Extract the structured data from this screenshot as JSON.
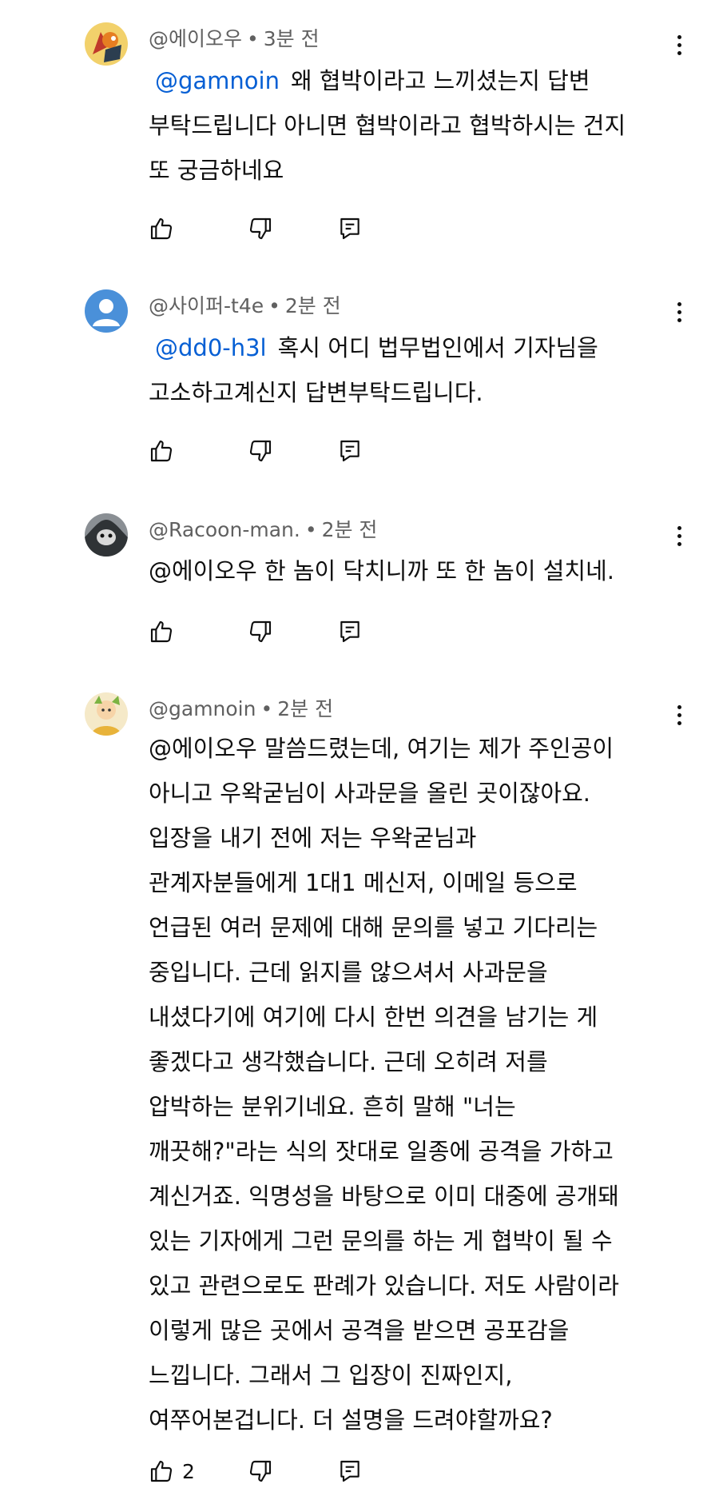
{
  "comments": [
    {
      "author": "@에이오우",
      "time": "3분 전",
      "lines": [
        {
          "mention": "@gamnoin",
          "text": "왜 협박이라고 느끼셨는지 답변"
        },
        {
          "mention": "",
          "text": "부탁드립니다 아니면 협박이라고 협박하시는 건지"
        },
        {
          "mention": "",
          "text": "또 궁금하네요"
        }
      ],
      "likes": ""
    },
    {
      "author": "@사이퍼-t4e",
      "time": "2분 전",
      "lines": [
        {
          "mention": "@dd0-h3l",
          "text": "혹시 어디 법무법인에서 기자님을"
        },
        {
          "mention": "",
          "text": "고소하고계신지 답변부탁드립니다."
        }
      ],
      "likes": ""
    },
    {
      "author": "@Racoon-man.",
      "time": "2분 전",
      "lines": [
        {
          "mention": "",
          "text": "@에이오우 한 놈이 닥치니까 또 한 놈이 설치네."
        }
      ],
      "likes": ""
    },
    {
      "author": "@gamnoin",
      "time": "2분 전",
      "lines": [
        {
          "mention": "",
          "text": "@에이오우 말씀드렸는데, 여기는 제가 주인공이"
        },
        {
          "mention": "",
          "text": "아니고 우왁굳님이 사과문을 올린 곳이잖아요."
        },
        {
          "mention": "",
          "text": "입장을 내기 전에 저는 우왁굳님과"
        },
        {
          "mention": "",
          "text": "관계자분들에게 1대1 메신저, 이메일 등으로"
        },
        {
          "mention": "",
          "text": "언급된 여러 문제에 대해 문의를 넣고 기다리는"
        },
        {
          "mention": "",
          "text": "중입니다. 근데 읽지를 않으셔서 사과문을"
        },
        {
          "mention": "",
          "text": "내셨다기에 여기에 다시 한번 의견을 남기는 게"
        },
        {
          "mention": "",
          "text": "좋겠다고 생각했습니다. 근데 오히려 저를"
        },
        {
          "mention": "",
          "text": "압박하는 분위기네요. 흔히 말해 \"너는"
        },
        {
          "mention": "",
          "text": "깨끗해?\"라는 식의 잣대로 일종에 공격을 가하고"
        },
        {
          "mention": "",
          "text": "계신거죠. 익명성을 바탕으로 이미 대중에 공개돼"
        },
        {
          "mention": "",
          "text": "있는 기자에게 그런 문의를 하는 게 협박이 될 수"
        },
        {
          "mention": "",
          "text": "있고 관련으로도 판례가 있습니다. 저도 사람이라"
        },
        {
          "mention": "",
          "text": "이렇게 많은 곳에서 공격을 받으면 공포감을"
        },
        {
          "mention": "",
          "text": "느낍니다. 그래서 그 입장이 진짜인지,"
        },
        {
          "mention": "",
          "text": "여쭈어본겁니다. 더 설명을 드려야할까요?"
        }
      ],
      "likes": "2"
    }
  ],
  "icons": {
    "like": "thumbs-up-icon",
    "dislike": "thumbs-down-icon",
    "reply": "reply-icon",
    "more": "more-vert-icon"
  },
  "colors": {
    "mention": "#065fd4",
    "meta": "#606060",
    "text": "#0f0f0f",
    "default_avatar": "#4a90d9"
  }
}
